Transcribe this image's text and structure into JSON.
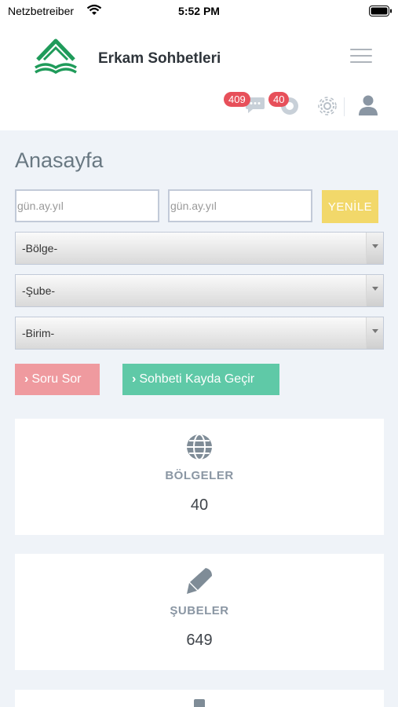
{
  "status_bar": {
    "carrier": "Netzbetreiber",
    "time": "5:52 PM"
  },
  "header": {
    "app_title": "Erkam Sohbetleri",
    "messages_count": "409",
    "tasks_count": "40"
  },
  "page": {
    "title": "Anasayfa"
  },
  "filters": {
    "start_date_placeholder": "gün.ay.yıl",
    "end_date_placeholder": "gün.ay.yıl",
    "refresh_label": "YENİLE",
    "region_select": "-Bölge-",
    "branch_select": "-Şube-",
    "unit_select": "-Birim-"
  },
  "actions": {
    "ask_label": "Soru Sor",
    "record_label": "Sohbeti Kayda Geçir"
  },
  "cards": [
    {
      "label": "BÖLGELER",
      "value": "40",
      "icon": "globe-icon"
    },
    {
      "label": "ŞUBELER",
      "value": "649",
      "icon": "pen-icon"
    }
  ],
  "colors": {
    "refresh": "#f2d86a",
    "ask": "#ef9a9f",
    "record": "#5fc9a7",
    "badge": "#e7505a",
    "logo": "#1f9b5a"
  }
}
